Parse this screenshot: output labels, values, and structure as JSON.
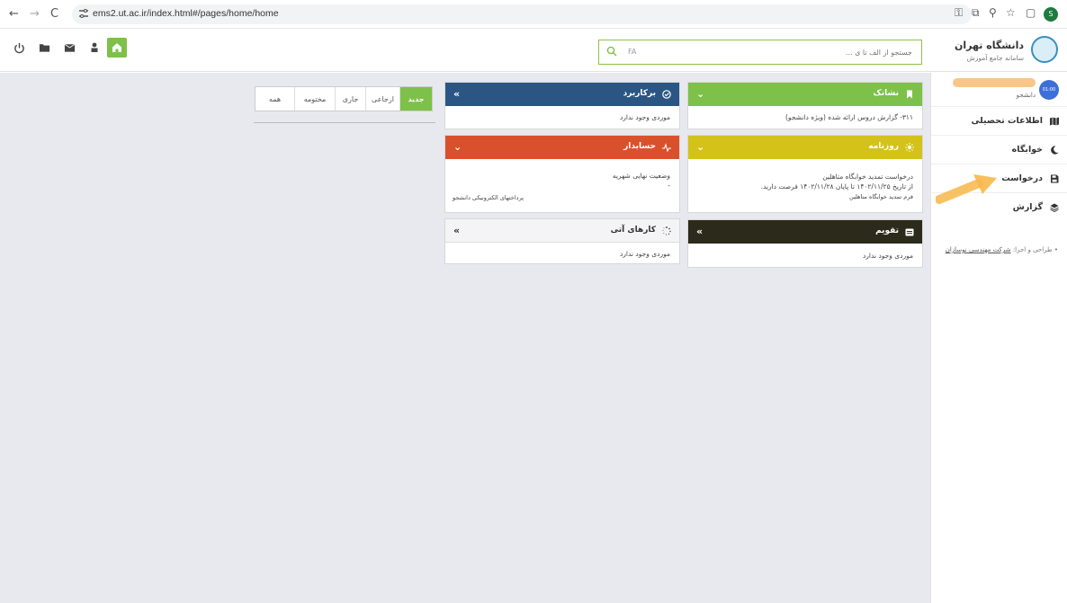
{
  "browser": {
    "url": "ems2.ut.ac.ir/index.html#/pages/home/home",
    "profile_initial": "S"
  },
  "header": {
    "search": {
      "lang": "FA",
      "placeholder": "جستجو از الف تا ی ..."
    },
    "brand": {
      "name": "دانشگاه تهران",
      "subtitle": "سامانه جامع آموزش"
    }
  },
  "sidebar": {
    "user": {
      "avatar_text": "01:00",
      "role": "دانشجو"
    },
    "items": [
      {
        "label": "اطلاعات تحصیلی",
        "icon": "map-icon"
      },
      {
        "label": "خوابگاه",
        "icon": "moon-icon"
      },
      {
        "label": "درخواست",
        "icon": "save-document-icon"
      },
      {
        "label": "گزارش",
        "icon": "layers-icon"
      }
    ],
    "credit_prefix": "طراحی و اجرا:",
    "credit_link": "شرکت مهندسی نوسازان"
  },
  "widgets": {
    "neshanak": {
      "title": "نشانک",
      "color": "#7dc04a",
      "lines": [
        "۳۱۱- گزارش دروس ارائه شده (ویژه دانشجو)"
      ]
    },
    "barkarbord": {
      "title": "برکاربرد",
      "color": "#2b5683",
      "lines": [
        "موردی وجود ندارد"
      ]
    },
    "roozname": {
      "title": "روزنامه",
      "color": "#d4c21a",
      "lines": [
        "درخواست تمدید خوابگاه متاهلین",
        "از تاریخ ۱۴۰۲/۱۱/۲۵ تا پایان ۱۴۰۲/۱۱/۲۸ فرصت دارید."
      ],
      "note": "فرم تمدید خوابگاه متاهلین"
    },
    "hesabdar": {
      "title": "حسابدار",
      "color": "#d9512c",
      "lines": [
        "وضعیت نهایی شهریه",
        "-"
      ],
      "note": "پرداختهای الکترونیکی دانشجو"
    },
    "taqvim": {
      "title": "تقویم",
      "color": "#2c2a1a",
      "lines": [
        "موردی وجود ندارد"
      ]
    },
    "karha": {
      "title": "کارهای آتی",
      "color": "#f4f4f6",
      "lines": [
        "موردی وجود ندارد"
      ]
    }
  },
  "tabs": [
    {
      "label": "جدید",
      "active": true
    },
    {
      "label": "ارجاعی",
      "active": false
    },
    {
      "label": "جاری",
      "active": false
    },
    {
      "label": "مختومه",
      "active": false
    },
    {
      "label": "همه",
      "active": false
    }
  ],
  "colors": {
    "accent": "#7dc04a",
    "main_bg": "#e8e8ef",
    "arrow": "#f7b84a"
  }
}
